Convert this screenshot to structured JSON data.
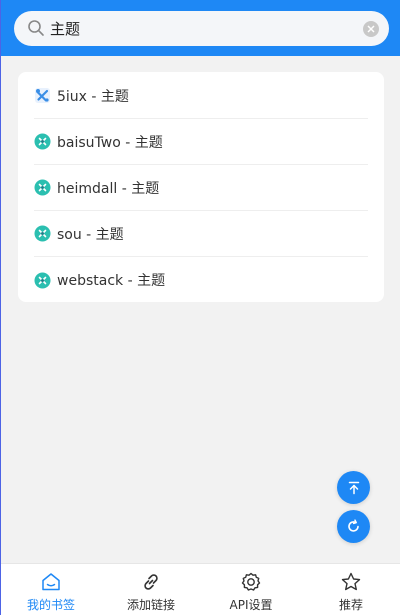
{
  "search": {
    "value": "主题",
    "clear_icon": "close-icon"
  },
  "bookmarks": [
    {
      "label": "5iux - 主题",
      "icon": "tools-icon"
    },
    {
      "label": "baisuTwo - 主题",
      "icon": "site-icon"
    },
    {
      "label": "heimdall - 主题",
      "icon": "site-icon"
    },
    {
      "label": "sou - 主题",
      "icon": "site-icon"
    },
    {
      "label": "webstack - 主题",
      "icon": "site-icon"
    }
  ],
  "fabs": {
    "top_icon": "scroll-to-top-icon",
    "refresh_icon": "refresh-icon"
  },
  "tabbar": {
    "items": [
      {
        "label": "我的书签",
        "icon": "home-icon",
        "active": true
      },
      {
        "label": "添加链接",
        "icon": "link-icon",
        "active": false
      },
      {
        "label": "API设置",
        "icon": "gear-icon",
        "active": false
      },
      {
        "label": "推荐",
        "icon": "star-icon",
        "active": false
      }
    ]
  },
  "colors": {
    "accent": "#1e88f5",
    "background": "#f2f2f2",
    "site_icon": "#2bbfb0"
  }
}
